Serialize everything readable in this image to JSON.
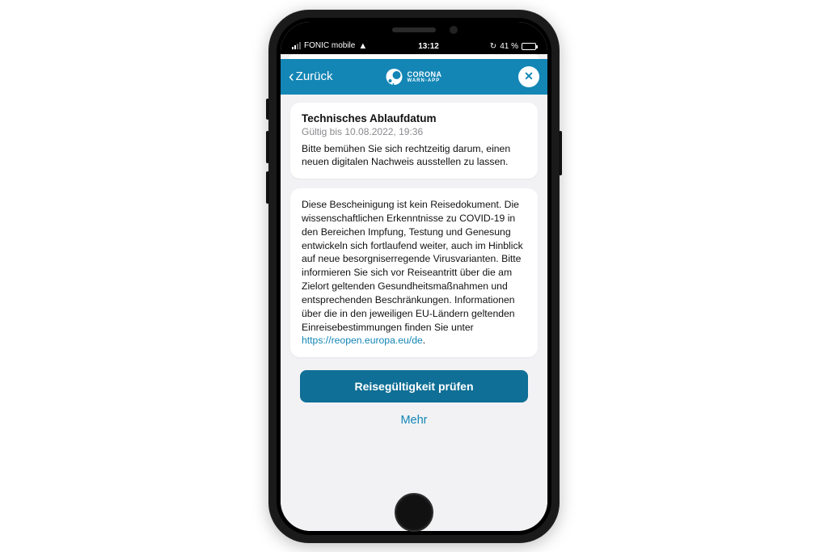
{
  "statusbar": {
    "carrier": "FONIC mobile",
    "time": "13:12",
    "battery_pct": "41 %"
  },
  "header": {
    "back_label": "Zurück",
    "brand_line1": "CORONA",
    "brand_line2": "WARN-APP"
  },
  "card1": {
    "title": "Technisches Ablaufdatum",
    "subtitle": "Gültig bis 10.08.2022, 19:36",
    "body": "Bitte bemühen Sie sich rechtzeitig darum, einen neuen digitalen Nachweis ausstellen zu lassen."
  },
  "card2": {
    "body": "Diese Bescheinigung ist kein Reisedokument. Die wissenschaftlichen Erkenntnisse zu COVID-19 in den Bereichen Impfung, Testung und Genesung entwickeln sich fortlaufend weiter, auch im Hinblick auf neue besorgniserregende Virusvarianten. Bitte informieren Sie sich vor Reiseantritt über die am Zielort geltenden Gesundheitsmaßnahmen und entsprechenden Beschränkungen. Informationen über die in den jeweiligen EU-Ländern geltenden Einreisebestimmungen finden Sie unter",
    "link_text": "https://reopen.europa.eu/de",
    "body_suffix": "."
  },
  "actions": {
    "primary": "Reisegültigkeit prüfen",
    "secondary": "Mehr"
  }
}
